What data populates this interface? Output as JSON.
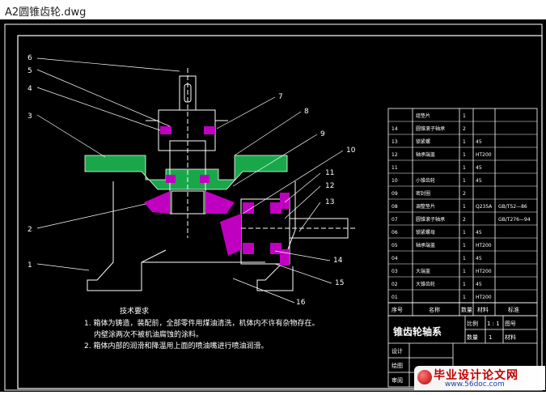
{
  "window": {
    "title": "A2圆锥齿轮.dwg"
  },
  "callouts": [
    "6",
    "5",
    "4",
    "3",
    "2",
    "1",
    "7",
    "8",
    "9",
    "10",
    "11",
    "12",
    "13",
    "14",
    "15",
    "16"
  ],
  "tech": {
    "heading": "技术要求",
    "line1": "1. 箱体为铸造，装配前，全部零件用煤油清洗，机体内不许有杂物存在。",
    "line2": "内壁涂两次不被机油腐蚀的涂料。",
    "line3": "2. 箱体内部的润滑和降温用上面的喷油嘴进行喷油润滑。"
  },
  "bom": {
    "rows": [
      {
        "no": "",
        "name": "组垫片",
        "qty": "1",
        "mat": "",
        "note": ""
      },
      {
        "no": "14",
        "name": "圆锥滚子轴承",
        "qty": "2",
        "mat": "",
        "note": ""
      },
      {
        "no": "13",
        "name": "锁紧螺",
        "qty": "1",
        "mat": "45",
        "note": ""
      },
      {
        "no": "12",
        "name": "轴承端盖",
        "qty": "1",
        "mat": "HT200",
        "note": ""
      },
      {
        "no": "11",
        "name": "",
        "qty": "1",
        "mat": "45",
        "note": ""
      },
      {
        "no": "10",
        "name": "小锥齿轮",
        "qty": "1",
        "mat": "45",
        "note": ""
      },
      {
        "no": "09",
        "name": "密封圈",
        "qty": "2",
        "mat": "",
        "note": ""
      },
      {
        "no": "08",
        "name": "调整垫片",
        "qty": "1",
        "mat": "Q235A",
        "note": "GB/T52—86"
      },
      {
        "no": "07",
        "name": "圆锥滚子轴承",
        "qty": "2",
        "mat": "",
        "note": "GB/T276—94"
      },
      {
        "no": "06",
        "name": "锁紧螺母",
        "qty": "1",
        "mat": "45",
        "note": ""
      },
      {
        "no": "05",
        "name": "轴承端盖",
        "qty": "1",
        "mat": "HT200",
        "note": ""
      },
      {
        "no": "04",
        "name": "",
        "qty": "1",
        "mat": "45",
        "note": ""
      },
      {
        "no": "03",
        "name": "大端盖",
        "qty": "1",
        "mat": "HT200",
        "note": ""
      },
      {
        "no": "02",
        "name": "大锥齿轮",
        "qty": "1",
        "mat": "45",
        "note": ""
      },
      {
        "no": "01",
        "name": "",
        "qty": "1",
        "mat": "HT200",
        "note": ""
      }
    ],
    "header": {
      "no": "序号",
      "name": "名称",
      "qty": "数量",
      "mat": "材料",
      "note": "标准"
    }
  },
  "title_block": {
    "name": "锥齿轮轴系",
    "scale_label": "比例",
    "scale_value": "1 : 1",
    "number_label": "图号",
    "qty_label": "数量",
    "qty_value": "1",
    "material_label": "材料",
    "design_label": "设计",
    "draw_label": "绘图",
    "review_label": "审阅"
  },
  "watermark": {
    "main": "毕业设计论文网",
    "url": "www.56doc.com"
  },
  "colors": {
    "green": "#19a74a",
    "magenta": "#c000c0",
    "line": "#ffffff"
  }
}
